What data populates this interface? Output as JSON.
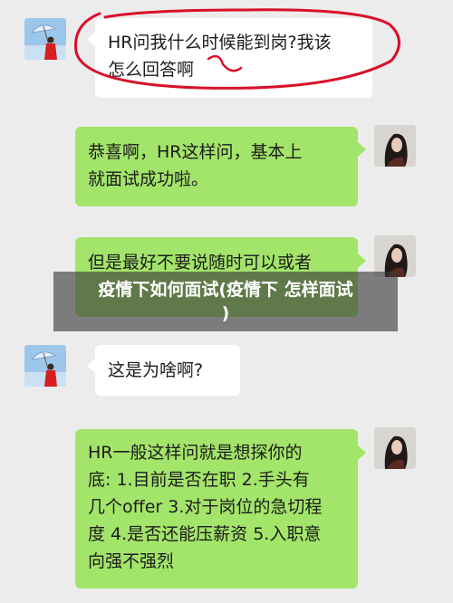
{
  "chat": {
    "messages": [
      {
        "sender": "other",
        "text": "HR问我什么时候能到岗?我该\n怎么回答啊"
      },
      {
        "sender": "self",
        "text": "恭喜啊，HR这样问，基本上\n就面试成功啦。"
      },
      {
        "sender": "self",
        "text": "但是最好不要说随时可以或者"
      },
      {
        "sender": "other",
        "text": "这是为啥啊?"
      },
      {
        "sender": "self",
        "text": "HR一般这样问就是想探你的\n底: 1.目前是否在职 2.手头有\n几个offer 3.对于岗位的急切程\n度 4.是否还能压薪资 5.入职意\n向强不强烈"
      }
    ]
  },
  "overlay": {
    "title": "疫情下如何面试(疫情下 怎样面试\n)"
  },
  "colors": {
    "self_bubble": "#a3e46a",
    "other_bubble": "#ffffff",
    "annotation": "#d8102a"
  },
  "icons": {
    "other_avatar": "umbrella-girl-avatar",
    "self_avatar": "portrait-avatar"
  }
}
